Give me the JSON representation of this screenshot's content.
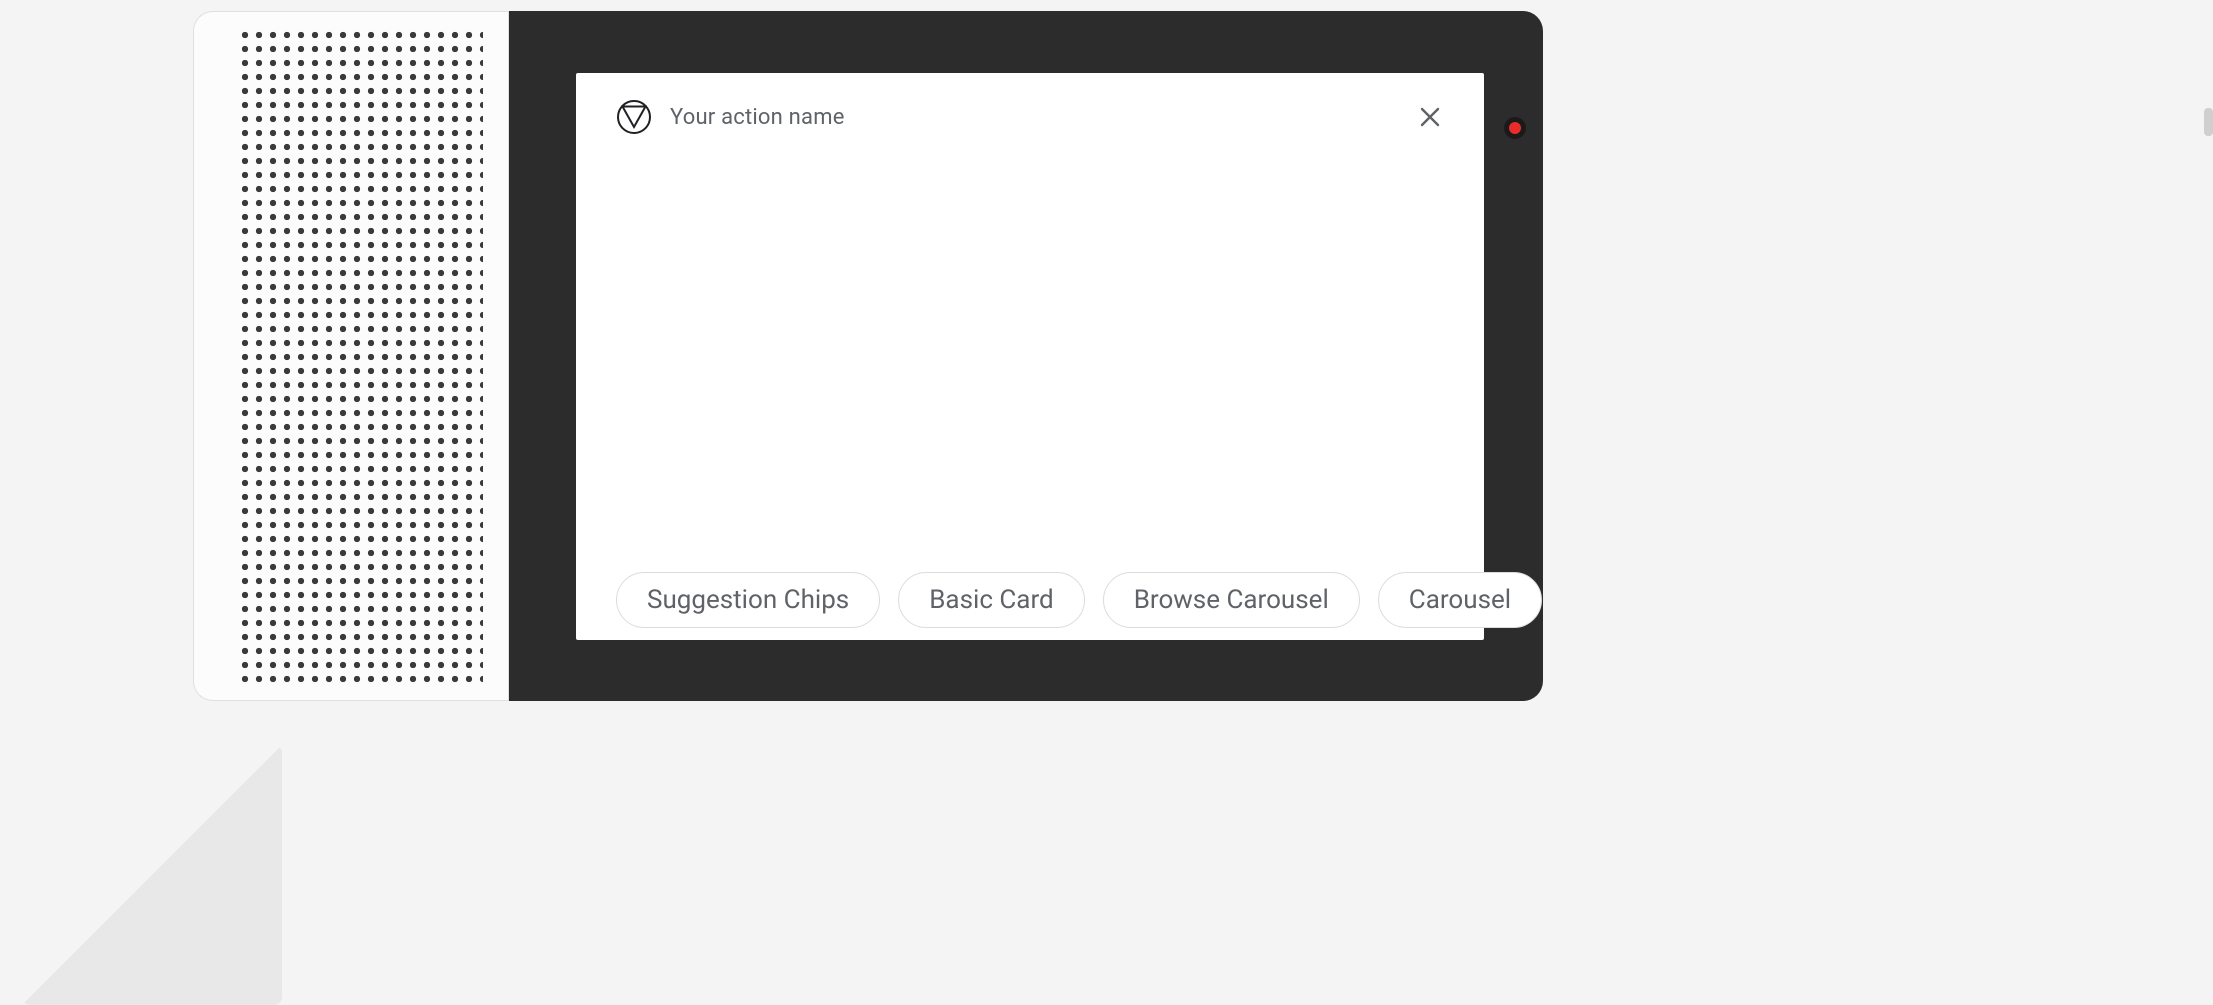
{
  "header": {
    "action_name": "Your action name",
    "logo_icon": "material-logo-icon",
    "close_icon": "close-icon"
  },
  "status": {
    "led_color": "#ea2b2b"
  },
  "chips": [
    {
      "label": "Suggestion Chips"
    },
    {
      "label": "Basic Card"
    },
    {
      "label": "Browse Carousel"
    },
    {
      "label": "Carousel"
    }
  ]
}
